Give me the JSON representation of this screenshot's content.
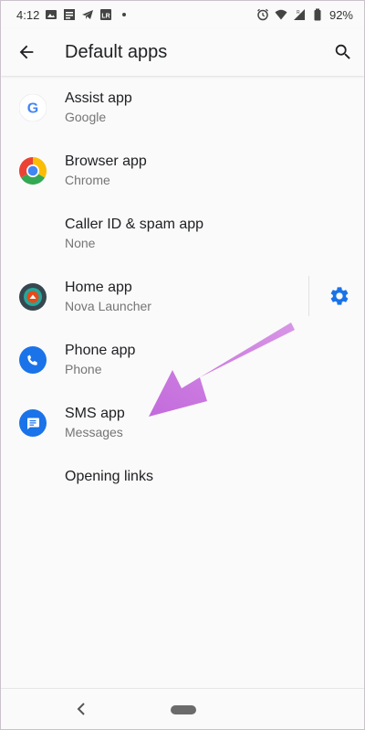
{
  "statusbar": {
    "time": "4:12",
    "battery": "92%"
  },
  "toolbar": {
    "title": "Default apps"
  },
  "items": [
    {
      "title": "Assist app",
      "subtitle": "Google",
      "icon": "google-icon"
    },
    {
      "title": "Browser app",
      "subtitle": "Chrome",
      "icon": "chrome-icon"
    },
    {
      "title": "Caller ID & spam app",
      "subtitle": "None",
      "icon": ""
    },
    {
      "title": "Home app",
      "subtitle": "Nova Launcher",
      "icon": "nova-launcher-icon"
    },
    {
      "title": "Phone app",
      "subtitle": "Phone",
      "icon": "phone-icon"
    },
    {
      "title": "SMS app",
      "subtitle": "Messages",
      "icon": "messages-icon"
    },
    {
      "title": "Opening links"
    }
  ],
  "colors": {
    "accent": "#1a73e8",
    "annotation_arrow": "#c874de"
  }
}
